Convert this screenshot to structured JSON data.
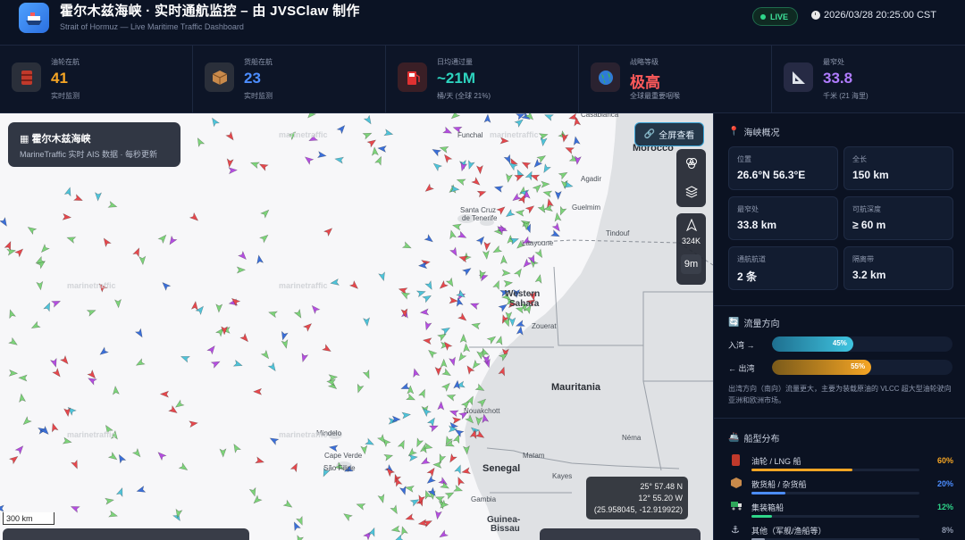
{
  "header": {
    "title": "霍尔木兹海峡 · 实时通航监控 – 由 JVSClaw 制作",
    "subtitle": "Strait of Hormuz — Live Maritime Traffic Dashboard",
    "live_label": "LIVE",
    "datetime": "2026/03/28 20:25:00 CST"
  },
  "stats": [
    {
      "label": "油轮在航",
      "value": "41",
      "sub": "实时监测",
      "color": "#f5a524",
      "icon": "oil-barrel-icon",
      "icon_bg": "#2a2f3a"
    },
    {
      "label": "货船在航",
      "value": "23",
      "sub": "实时监测",
      "color": "#4c8dff",
      "icon": "cargo-box-icon",
      "icon_bg": "#2a2f3a"
    },
    {
      "label": "日均通过量",
      "value": "~21M",
      "sub": "桶/天 (全球 21%)",
      "color": "#2dd4bf",
      "icon": "fuel-pump-icon",
      "icon_bg": "#3a1f26"
    },
    {
      "label": "战略等级",
      "value": "极高",
      "sub": "全球最重要咽喉",
      "color": "#ff5a5a",
      "icon": "globe-icon",
      "icon_bg": "#2a2230"
    },
    {
      "label": "最窄处",
      "value": "33.8",
      "sub": "千米 (21 海里)",
      "color": "#b07cff",
      "icon": "triangle-ruler-icon",
      "icon_bg": "#262a44"
    }
  ],
  "map": {
    "info_title": "霍尔木兹海峡",
    "info_sub": "MarineTraffic 实时 AIS 数据 · 每秒更新",
    "fullscreen_label": "全屏查看",
    "speed_label": "324K",
    "time_label": "9m",
    "scale_label": "300 km",
    "coord_lat": "25° 57.48 N",
    "coord_lon": "12° 55.20 W",
    "coord_dec": "(25.958045, -12.919922)",
    "place_labels": [
      {
        "text": "Morocco",
        "cls": "big"
      },
      {
        "text": "Western",
        "cls": "mid"
      },
      {
        "text": "Sahara",
        "cls": "mid"
      },
      {
        "text": "Mauritania",
        "cls": "big"
      },
      {
        "text": "Senegal",
        "cls": "big"
      },
      {
        "text": "Guinea-",
        "cls": "mid"
      },
      {
        "text": "Bissau",
        "cls": "mid"
      },
      {
        "text": "Agadir",
        "cls": "sm"
      },
      {
        "text": "Guelmim",
        "cls": "sm"
      },
      {
        "text": "Tindouf",
        "cls": "sm"
      },
      {
        "text": "Laayoune",
        "cls": "sm"
      },
      {
        "text": "Santa Cruz",
        "cls": "sm"
      },
      {
        "text": "de Tenerife",
        "cls": "sm"
      },
      {
        "text": "Funchal",
        "cls": "sm"
      },
      {
        "text": "Casablanca",
        "cls": "sm"
      },
      {
        "text": "Zouerat",
        "cls": "sm"
      },
      {
        "text": "Nouakchott",
        "cls": "sm"
      },
      {
        "text": "Néma",
        "cls": "sm"
      },
      {
        "text": "Matam",
        "cls": "sm"
      },
      {
        "text": "Kayes",
        "cls": "sm"
      },
      {
        "text": "Gambia",
        "cls": "sm"
      },
      {
        "text": "Mindelo",
        "cls": "sm"
      },
      {
        "text": "Cape Verde",
        "cls": "sm"
      },
      {
        "text": "São Filipe",
        "cls": "sm"
      },
      {
        "text": "marinetraffic",
        "cls": "wm"
      },
      {
        "text": "marinetraffic",
        "cls": "wm"
      },
      {
        "text": "marinetraffic",
        "cls": "wm"
      },
      {
        "text": "marinetraffic",
        "cls": "wm"
      },
      {
        "text": "marinetraffic",
        "cls": "wm"
      },
      {
        "text": "marinetraffic",
        "cls": "wm"
      }
    ]
  },
  "overview": {
    "title": "海峡概况",
    "items": [
      {
        "label": "位置",
        "value": "26.6°N 56.3°E"
      },
      {
        "label": "全长",
        "value": "150 km"
      },
      {
        "label": "最窄处",
        "value": "33.8 km"
      },
      {
        "label": "可航深度",
        "value": "≥ 60 m"
      },
      {
        "label": "通航航道",
        "value": "2 条"
      },
      {
        "label": "隔离带",
        "value": "3.2 km"
      }
    ]
  },
  "flow": {
    "title": "流量方向",
    "inbound_label": "入湾 →",
    "inbound_pct": 45,
    "inbound_text": "45%",
    "outbound_label": "← 出湾",
    "outbound_pct": 55,
    "outbound_text": "55%",
    "note": "出湾方向（南向）流量更大，主要为装载原油的 VLCC 超大型油轮驶向亚洲和欧洲市场。"
  },
  "vessels": {
    "title": "船型分布",
    "items": [
      {
        "label": "油轮 / LNG 船",
        "pct": 60,
        "text": "60%",
        "color": "#f5a524",
        "icon": "oil-barrel-icon"
      },
      {
        "label": "散货船 / 杂货船",
        "pct": 20,
        "text": "20%",
        "color": "#4c8dff",
        "icon": "cargo-box-icon"
      },
      {
        "label": "集装箱船",
        "pct": 12,
        "text": "12%",
        "color": "#2fd68a",
        "icon": "container-truck-icon"
      },
      {
        "label": "其他（军舰/渔船等）",
        "pct": 8,
        "text": "8%",
        "color": "#8d97ad",
        "icon": "anchor-icon"
      }
    ]
  }
}
